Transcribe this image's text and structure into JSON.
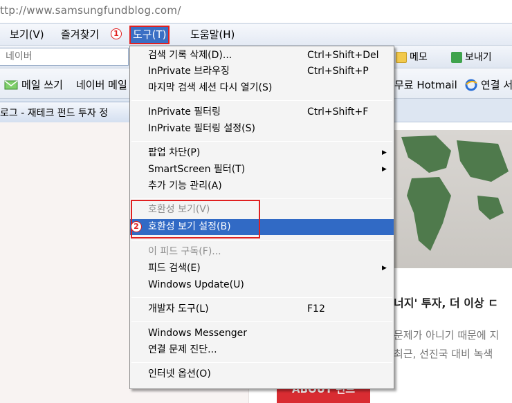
{
  "address_bar": {
    "url": "ttp://www.samsungfundblog.com/"
  },
  "menubar": {
    "items": [
      {
        "label": "보기(V)"
      },
      {
        "label": "즐겨찾기"
      },
      {
        "label": "도구(T)"
      },
      {
        "label": "도움말(H)"
      }
    ],
    "badge_1": "1"
  },
  "toolbar": {
    "search_placeholder": "네이버",
    "memo_label": "메모",
    "send_label": "보내기"
  },
  "favorites_bar": {
    "mail_label": "메일 쓰기",
    "naver_label": "네이버 메일",
    "hotmail_label": "무료 Hotmail",
    "connect_label": "연결 서"
  },
  "tab": {
    "title": "로그 - 재테크 펀드 투자 정"
  },
  "page": {
    "headline": "너지' 투자, 더 이상 ㄷ",
    "body_line_1": "문제가 아니기 때문에 지",
    "body_line_2": "최근, 선진국 대비 녹색",
    "about_label": "ABOUT 펀드"
  },
  "tools_menu": {
    "items": [
      {
        "label": "검색 기록 삭제(D)...",
        "shortcut": "Ctrl+Shift+Del"
      },
      {
        "label": "InPrivate 브라우징",
        "shortcut": "Ctrl+Shift+P"
      },
      {
        "label": "마지막 검색 세션 다시 열기(S)",
        "shortcut": ""
      },
      {
        "label": "InPrivate 필터링",
        "shortcut": "Ctrl+Shift+F"
      },
      {
        "label": "InPrivate 필터링 설정(S)",
        "shortcut": ""
      },
      {
        "label": "팝업 차단(P)",
        "shortcut": ""
      },
      {
        "label": "SmartScreen 필터(T)",
        "shortcut": ""
      },
      {
        "label": "추가 기능 관리(A)",
        "shortcut": ""
      },
      {
        "label": "호환성 보기(V)",
        "shortcut": ""
      },
      {
        "label": "호환성 보기 설정(B)",
        "shortcut": ""
      },
      {
        "label": "이 피드 구독(F)...",
        "shortcut": ""
      },
      {
        "label": "피드 검색(E)",
        "shortcut": ""
      },
      {
        "label": "Windows Update(U)",
        "shortcut": ""
      },
      {
        "label": "개발자 도구(L)",
        "shortcut": "F12"
      },
      {
        "label": "Windows Messenger",
        "shortcut": ""
      },
      {
        "label": "연결 문제 진단...",
        "shortcut": ""
      },
      {
        "label": "인터넷 옵션(O)",
        "shortcut": ""
      }
    ],
    "badge_2": "2"
  },
  "colors": {
    "highlight": "#316ac5",
    "annotation_red": "#e02020",
    "about_red": "#d92c32"
  }
}
